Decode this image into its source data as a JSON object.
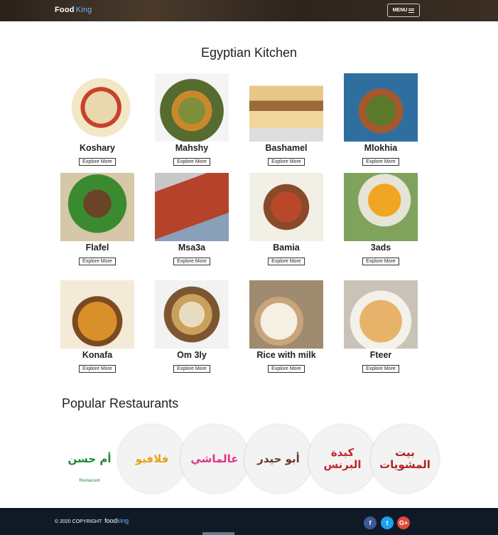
{
  "header": {
    "brand_part1": "Food",
    "brand_part2": "King",
    "menu_label": "MENU"
  },
  "kitchen": {
    "title": "Egyptian Kitchen",
    "explore_label": "Explore More",
    "dishes": [
      {
        "name": "Koshary"
      },
      {
        "name": "Mahshy"
      },
      {
        "name": "Bashamel"
      },
      {
        "name": "Mlokhia"
      },
      {
        "name": "Flafel"
      },
      {
        "name": "Msa3a"
      },
      {
        "name": "Bamia"
      },
      {
        "name": "3ads"
      },
      {
        "name": "Konafa"
      },
      {
        "name": "Om 3ly"
      },
      {
        "name": "Rice with milk"
      },
      {
        "name": "Fteer"
      }
    ]
  },
  "popular": {
    "title": "Popular Restaurants",
    "restaurants": [
      {
        "logo_text": "أم حسن",
        "sub": "Restaurant",
        "color": "#1e8a3a"
      },
      {
        "logo_text": "فلافيو",
        "sub": "",
        "color": "#e6a21a"
      },
      {
        "logo_text": "عالماشي",
        "sub": "",
        "color": "#e0357f"
      },
      {
        "logo_text": "أبو حيدر",
        "sub": "",
        "color": "#6b3a2a"
      },
      {
        "logo_text": "كبدة البرنس",
        "sub": "",
        "color": "#c1272d"
      },
      {
        "logo_text": "بيت المشويات",
        "sub": "",
        "color": "#b22222"
      }
    ]
  },
  "footer": {
    "copyright": "© 2020 COPYRIGHT",
    "brand_part1": "food",
    "brand_part2": "king",
    "social": [
      {
        "icon": "facebook-icon",
        "glyph": "f",
        "color": "#3b5998"
      },
      {
        "icon": "twitter-icon",
        "glyph": "t",
        "color": "#1da1f2"
      },
      {
        "icon": "google-plus-icon",
        "glyph": "G+",
        "color": "#dd4b39"
      }
    ]
  }
}
